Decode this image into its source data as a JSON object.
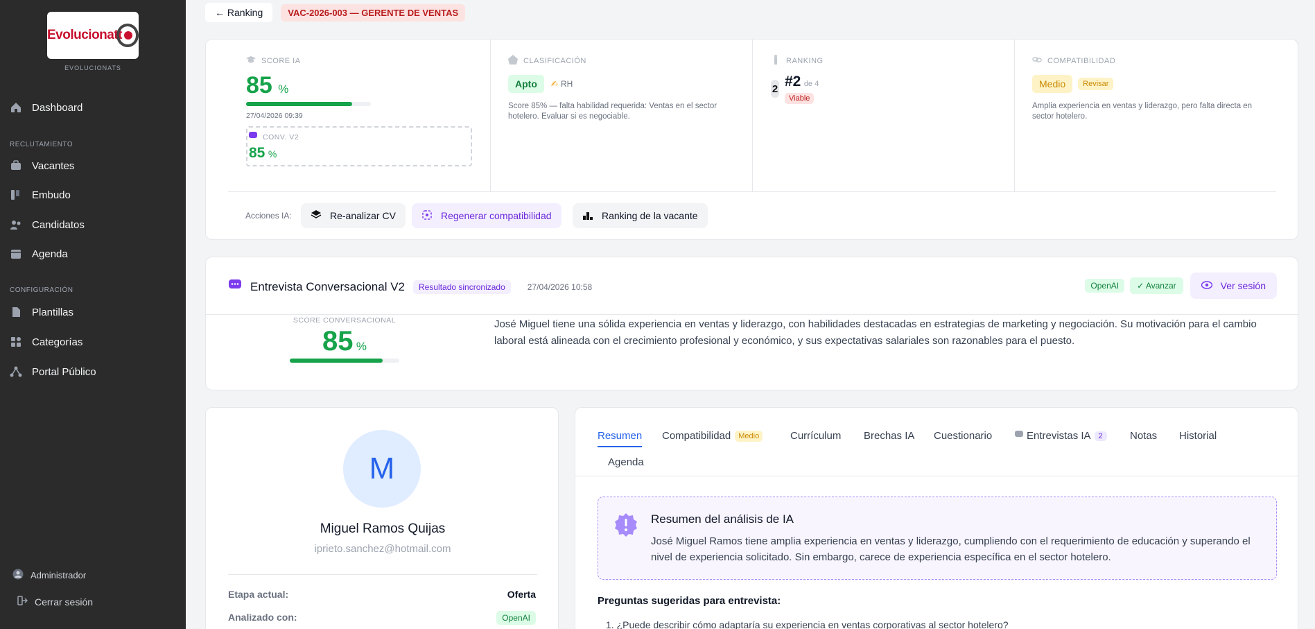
{
  "sidebar": {
    "logo_text": "Evolucionatt",
    "brand_sub": "EVOLUCIONATS",
    "dashboard": "Dashboard",
    "section_recruit": "RECLUTAMIENTO",
    "vacantes": "Vacantes",
    "embudo": "Embudo",
    "candidatos": "Candidatos",
    "agenda": "Agenda",
    "section_config": "CONFIGURACIÓN",
    "plantillas": "Plantillas",
    "categorias": "Categorías",
    "portal": "Portal Público",
    "admin": "Administrador",
    "logout": "Cerrar sesión"
  },
  "topbar": {
    "back": "← Ranking",
    "vacancy": "VAC-2026-003 — GERENTE DE VENTAS"
  },
  "kpis": {
    "score_label": "SCORE IA",
    "score_value": "85",
    "score_unit": "%",
    "score_pct": 85,
    "score_date": "27/04/2026 09:39",
    "conv_label": "CONV. V2",
    "conv_value": "85",
    "conv_unit": "%",
    "class_label": "CLASIFICACIÓN",
    "class_value": "Apto",
    "class_by": "RH",
    "class_note": "Score 85% — falta habilidad requerida: Ventas en el sector hotelero. Evaluar si es negociable.",
    "ranking_label": "RANKING",
    "ranking_medal": "2",
    "ranking_pos": "#2",
    "ranking_of": "de 4",
    "ranking_status": "Viable",
    "compat_label": "COMPATIBILIDAD",
    "compat_value": "Medio",
    "compat_action": "Revisar",
    "compat_note": "Amplia experiencia en ventas y liderazgo, pero falta directa en sector hotelero."
  },
  "actions": {
    "label": "Acciones IA:",
    "reanalyze": "Re-analizar CV",
    "regenerate": "Regenerar compatibilidad",
    "ranking": "Ranking de la vacante"
  },
  "interview": {
    "title": "Entrevista Conversacional V2",
    "sync_badge": "Resultado sincronizado",
    "date": "27/04/2026 10:58",
    "provider": "OpenAI",
    "decision": "✓ Avanzar",
    "view_session": "Ver sesión",
    "score_label": "SCORE CONVERSACIONAL",
    "score_value": "85",
    "score_unit": "%",
    "score_pct": 85,
    "summary": "José Miguel tiene una sólida experiencia en ventas y liderazgo, con habilidades destacadas en estrategias de marketing y negociación. Su motivación para el cambio laboral está alineada con el crecimiento profesional y económico, y sus expectativas salariales son razonables para el puesto."
  },
  "profile": {
    "initial": "M",
    "name": "Miguel Ramos Quijas",
    "email": "iprieto.sanchez@hotmail.com",
    "stage_label": "Etapa actual:",
    "stage_value": "Oferta",
    "analyzed_label": "Analizado con:",
    "analyzed_value": "OpenAI"
  },
  "tabs": {
    "resumen": "Resumen",
    "compat": "Compatibilidad",
    "compat_badge": "Medio",
    "cv": "Currículum",
    "brechas": "Brechas IA",
    "cuestionario": "Cuestionario",
    "entrevistas": "Entrevistas IA",
    "entrevistas_count": "2",
    "notas": "Notas",
    "historial": "Historial",
    "agenda": "Agenda"
  },
  "analysis": {
    "title": "Resumen del análisis de IA",
    "body": "José Miguel Ramos tiene amplia experiencia en ventas y liderazgo, cumpliendo con el requerimiento de educación y superando el nivel de experiencia solicitado. Sin embargo, carece de experiencia específica en el sector hotelero.",
    "questions_title": "Preguntas sugeridas para entrevista:",
    "question_1": "1. ¿Puede describir cómo adaptaría su experiencia en ventas corporativas al sector hotelero?"
  },
  "colors": {
    "sidebar_bg": "#2b2b2b",
    "accent_green": "#16a34a",
    "accent_purple": "#6d28d9",
    "accent_blue": "#2563eb"
  }
}
